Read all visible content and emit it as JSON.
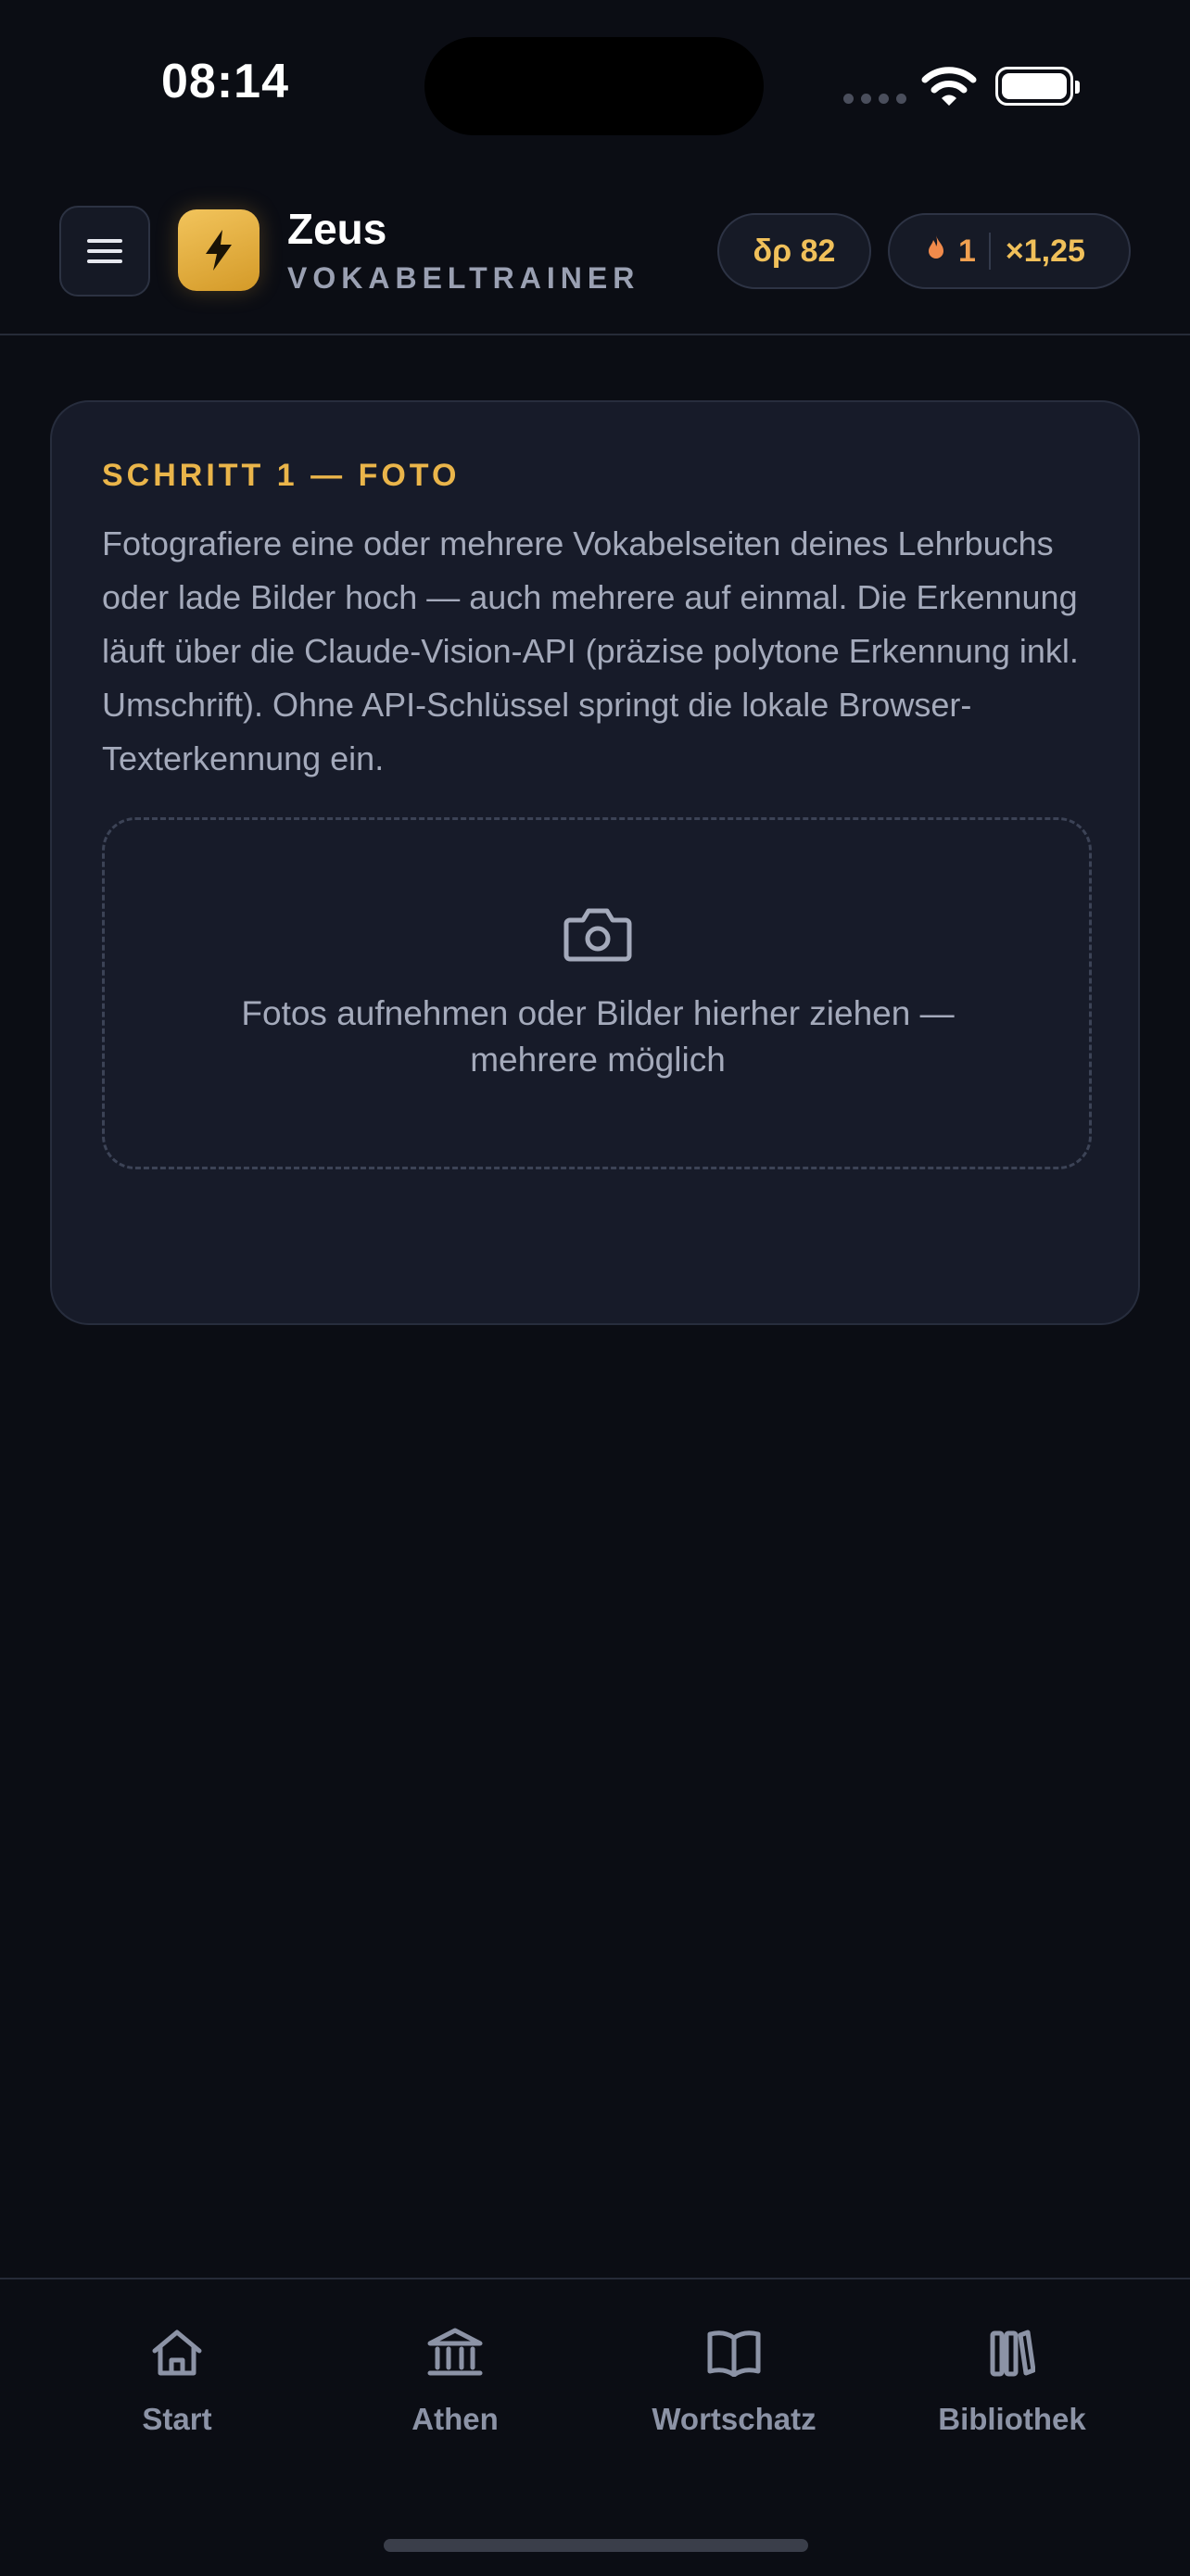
{
  "status_bar": {
    "time": "08:14"
  },
  "header": {
    "app_name": "Zeus",
    "app_subtitle": "VOKABELTRAINER",
    "xp_label": "δρ 82",
    "streak_count": "1",
    "multiplier": "×1,25",
    "accent_color": "#f0c05a"
  },
  "card": {
    "step_title": "SCHRITT 1 — FOTO",
    "description": "Fotografiere eine oder mehrere Vokabelseiten deines Lehrbuchs oder lade Bilder hoch — auch mehrere auf einmal. Die Erkennung läuft über die Claude-Vision-API (präzise polytone Erkennung inkl. Umschrift). Ohne API-Schlüssel springt die lokale Browser-Texterkennung ein.",
    "dropzone_text": "Fotos aufnehmen oder Bilder hierher ziehen — mehrere möglich",
    "dropzone_icon": "camera-icon"
  },
  "bottom_nav": {
    "items": [
      {
        "label": "Start",
        "icon": "home-icon"
      },
      {
        "label": "Athen",
        "icon": "temple-icon"
      },
      {
        "label": "Wortschatz",
        "icon": "book-icon"
      },
      {
        "label": "Bibliothek",
        "icon": "library-icon"
      }
    ]
  }
}
